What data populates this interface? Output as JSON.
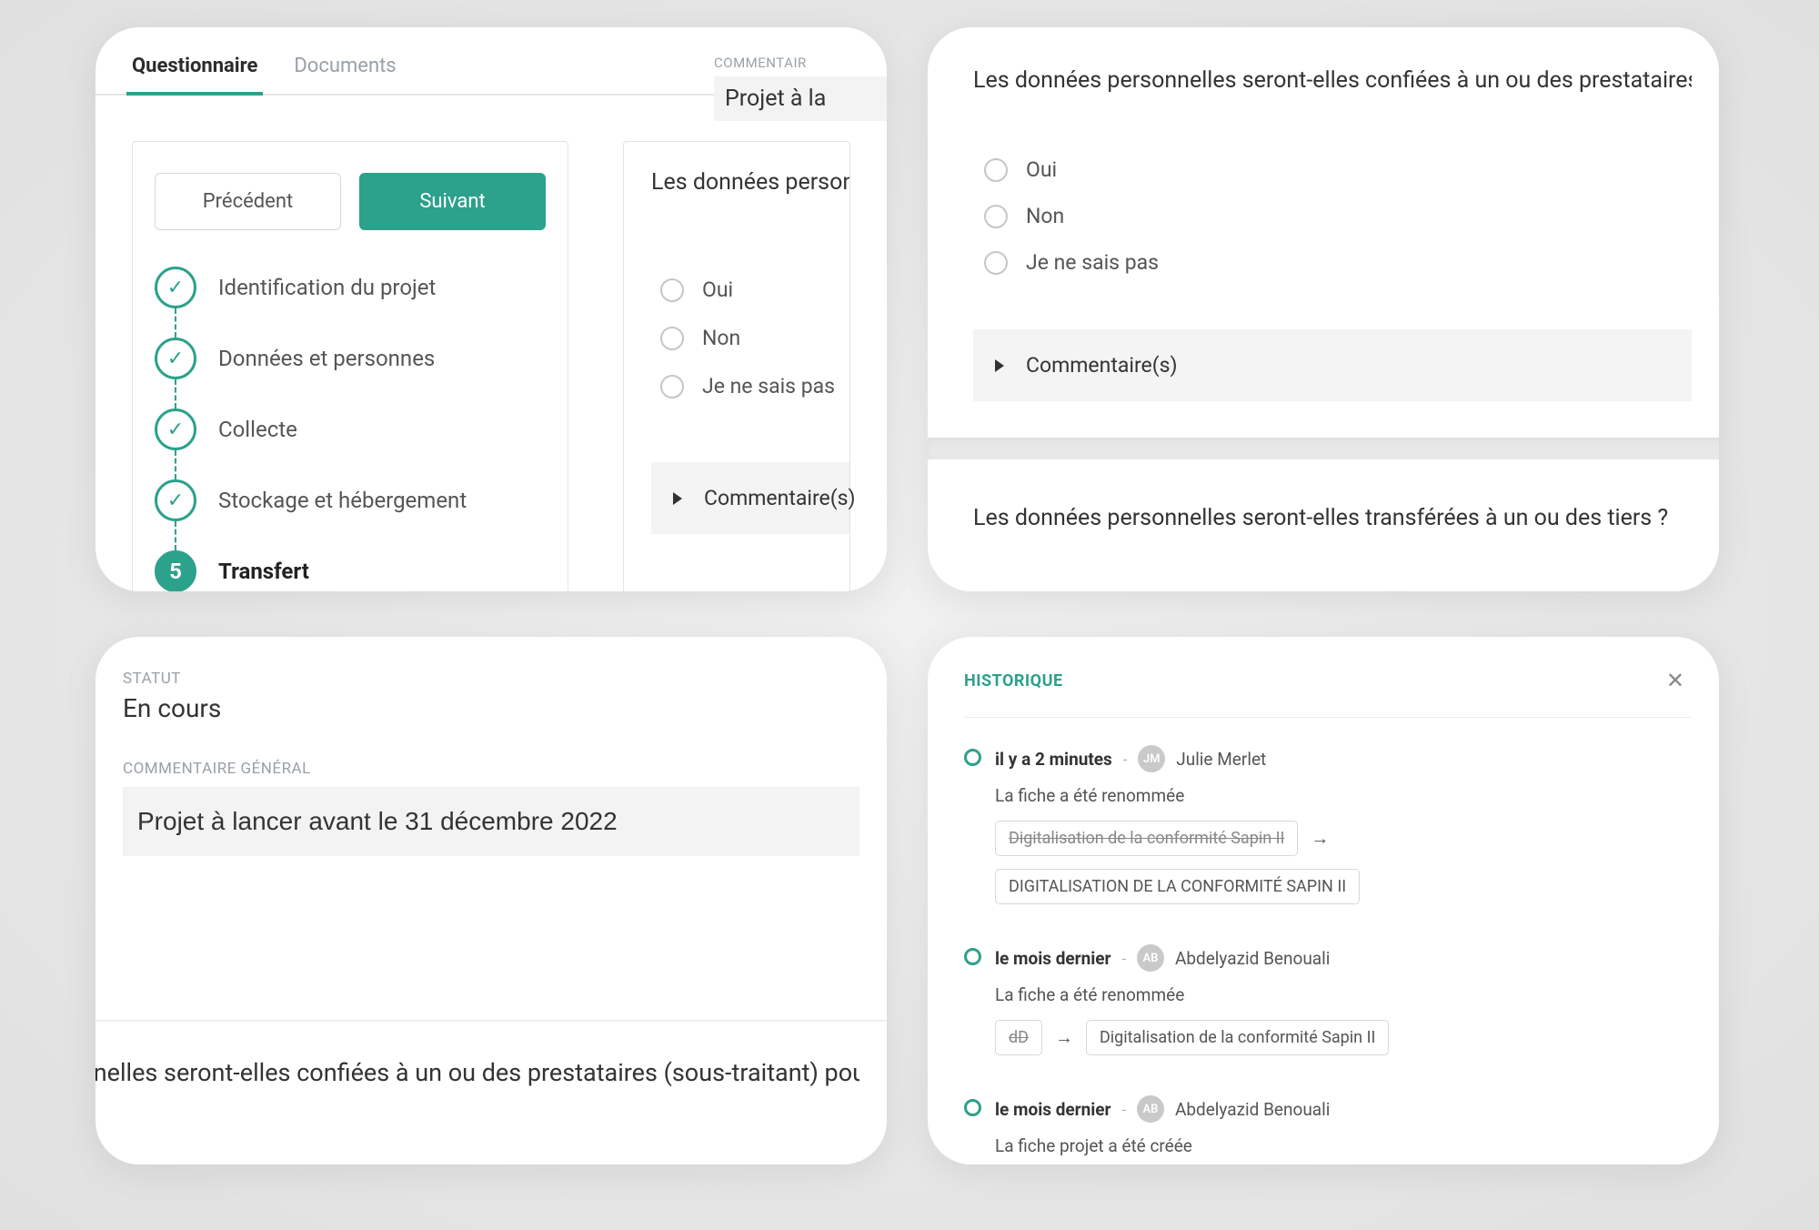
{
  "card1": {
    "tabs": [
      "Questionnaire",
      "Documents"
    ],
    "comment_label": "COMMENTAIR",
    "comment_value": "Projet à la",
    "prev_btn": "Précédent",
    "next_btn": "Suivant",
    "steps": [
      {
        "label": "Identification du projet"
      },
      {
        "label": "Données et personnes"
      },
      {
        "label": "Collecte"
      },
      {
        "label": "Stockage et hébergement"
      },
      {
        "num": "5",
        "label": "Transfert"
      }
    ],
    "question": "Les données personnelles s",
    "options": [
      "Oui",
      "Non",
      "Je ne sais pas"
    ],
    "comments_label": "Commentaire(s)"
  },
  "card2": {
    "question1": "Les données personnelles seront-elles confiées à un ou des prestataires (sous-traitant)",
    "options": [
      "Oui",
      "Non",
      "Je ne sais pas"
    ],
    "comments_label": "Commentaire(s)",
    "question2": "Les données personnelles seront-elles transférées à un ou des tiers ?"
  },
  "card3": {
    "status_label": "STATUT",
    "status_value": "En cours",
    "comment_label": "COMMENTAIRE GÉNÉRAL",
    "comment_value": "Projet à lancer avant le 31 décembre 2022",
    "question": "ersonnelles seront-elles confiées à un ou des prestataires (sous-traitant) pour"
  },
  "card4": {
    "title": "HISTORIQUE",
    "items": [
      {
        "time": "il y a 2 minutes",
        "initials": "JM",
        "user": "Julie Merlet",
        "desc": "La fiche a été renommée",
        "from": "Digitalisation de la conformité Sapin II",
        "to": "DIGITALISATION DE LA CONFORMITÉ SAPIN II"
      },
      {
        "time": "le mois dernier",
        "initials": "AB",
        "user": "Abdelyazid Benouali",
        "desc": "La fiche a été renommée",
        "from": "dD",
        "to": "Digitalisation de la conformité Sapin II"
      },
      {
        "time": "le mois dernier",
        "initials": "AB",
        "user": "Abdelyazid Benouali",
        "desc": "La fiche projet a été créée"
      }
    ]
  }
}
